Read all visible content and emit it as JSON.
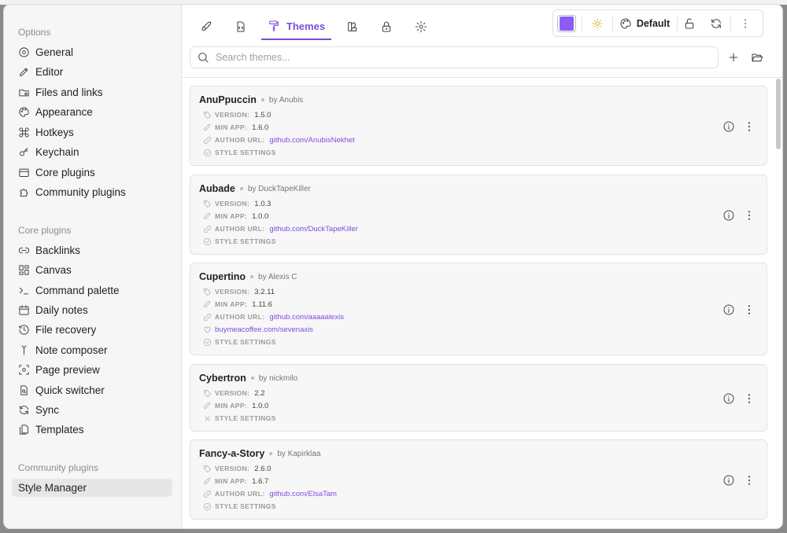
{
  "sidebar": {
    "options_title": "Options",
    "options_items": [
      {
        "label": "General",
        "icon": "gear-icon"
      },
      {
        "label": "Editor",
        "icon": "pen-icon"
      },
      {
        "label": "Files and links",
        "icon": "folder-link-icon"
      },
      {
        "label": "Appearance",
        "icon": "palette-icon"
      },
      {
        "label": "Hotkeys",
        "icon": "command-icon"
      },
      {
        "label": "Keychain",
        "icon": "key-icon"
      },
      {
        "label": "Core plugins",
        "icon": "calendar-box-icon"
      },
      {
        "label": "Community plugins",
        "icon": "puzzle-icon"
      }
    ],
    "core_title": "Core plugins",
    "core_items": [
      {
        "label": "Backlinks",
        "icon": "backlinks-icon"
      },
      {
        "label": "Canvas",
        "icon": "canvas-grid-icon"
      },
      {
        "label": "Command palette",
        "icon": "terminal-icon"
      },
      {
        "label": "Daily notes",
        "icon": "calendar-icon"
      },
      {
        "label": "File recovery",
        "icon": "history-icon"
      },
      {
        "label": "Note composer",
        "icon": "merge-icon"
      },
      {
        "label": "Page preview",
        "icon": "eye-scan-icon"
      },
      {
        "label": "Quick switcher",
        "icon": "file-search-icon"
      },
      {
        "label": "Sync",
        "icon": "refresh-icon"
      },
      {
        "label": "Templates",
        "icon": "files-icon"
      }
    ],
    "community_title": "Community plugins",
    "community_items": [
      {
        "label": "Style Manager",
        "active": true
      }
    ]
  },
  "tabs": {
    "active_label": "Themes",
    "items": [
      "rocket-icon",
      "code-file-icon",
      "paint-roller-icon",
      "swatch-book-icon",
      "lock-icon",
      "gear-icon"
    ]
  },
  "toolbar": {
    "accent_color": "#8b5cf6",
    "theme_label": "Default",
    "icons": [
      "sun-icon",
      "palette-icon",
      "unlock-icon",
      "refresh-icon",
      "more-vertical-icon"
    ]
  },
  "search": {
    "placeholder": "Search themes..."
  },
  "labels": {
    "version": "VERSION:",
    "min_app": "MIN APP:",
    "author_url": "AUTHOR URL:",
    "style_settings": "STYLE SETTINGS"
  },
  "themes": [
    {
      "name": "AnuPpuccin",
      "by": "by Anubis",
      "version": "1.5.0",
      "min_app": "1.6.0",
      "author_url": "github.com/AnubisNekhet"
    },
    {
      "name": "Aubade",
      "by": "by DuckTapeKiller",
      "version": "1.0.3",
      "min_app": "1.0.0",
      "author_url": "github.com/DuckTapeKiller"
    },
    {
      "name": "Cupertino",
      "by": "by Alexis C",
      "version": "3.2.11",
      "min_app": "1.11.6",
      "author_url": "github.com/aaaaalexis",
      "donate_url": "buymeacoffee.com/sevenaxis"
    },
    {
      "name": "Cybertron",
      "by": "by nickmilo",
      "version": "2.2",
      "min_app": "1.0.0"
    },
    {
      "name": "Fancy-a-Story",
      "by": "by Kapirklaa",
      "version": "2.6.0",
      "min_app": "1.6.7",
      "author_url": "github.com/ElsaTam"
    }
  ],
  "colors": {
    "accent": "#7c4ddc",
    "swatch": "#8b5cf6"
  }
}
